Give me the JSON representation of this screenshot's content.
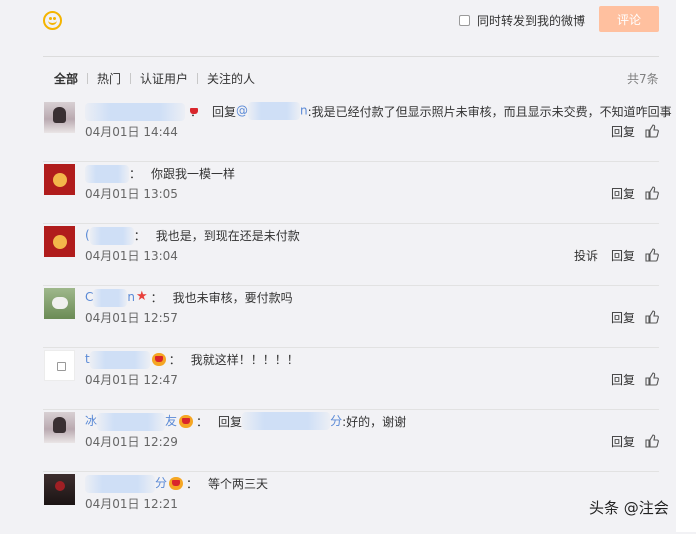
{
  "toolbar": {
    "repost_label": "同时转发到我的微博",
    "comment_button": "评论"
  },
  "filters": {
    "tabs": [
      "全部",
      "热门",
      "认证用户",
      "关注的人"
    ],
    "total": "共7条"
  },
  "comments": [
    {
      "user_visible_start": "",
      "user_visible_end": "",
      "badge": "crown",
      "reply_prefix": "回复",
      "mention_start": "@",
      "mention_end": "n",
      "text": ":我是已经付款了但显示照片未审核，而且显示未交费，不知道咋回事",
      "time": "04月01日 14:44",
      "actions": [
        "回复"
      ]
    },
    {
      "user_visible_start": "",
      "user_visible_end": "",
      "badge": "",
      "text": "你跟我一模一样",
      "time": "04月01日 13:05",
      "actions": [
        "回复"
      ]
    },
    {
      "user_visible_start": "(",
      "user_visible_end": "",
      "badge": "",
      "text": "我也是，到现在还是未付款",
      "time": "04月01日 13:04",
      "actions": [
        "投诉",
        "回复"
      ]
    },
    {
      "user_visible_start": "C",
      "user_visible_end": "n",
      "badge": "star",
      "text": "我也未审核，要付款吗",
      "time": "04月01日 12:57",
      "actions": [
        "回复"
      ]
    },
    {
      "user_visible_start": "t",
      "user_visible_end": "",
      "badge": "crown",
      "text": "我就这样！！！！！",
      "time": "04月01日 12:47",
      "actions": [
        "回复"
      ]
    },
    {
      "user_visible_start": "冰",
      "user_visible_end": "友",
      "badge": "crown",
      "reply_prefix": "回复",
      "mention_start": "",
      "mention_end": "分",
      "text": ":好的，谢谢",
      "time": "04月01日 12:29",
      "actions": [
        "回复"
      ]
    },
    {
      "user_visible_start": "",
      "user_visible_end": "分",
      "badge": "crown",
      "text": "等个两三天",
      "time": "04月01日 12:21",
      "actions": [
        "回复"
      ]
    }
  ],
  "watermark": "头条 @注会",
  "colors": {
    "link": "#5b8ad6",
    "comment_button_bg": "#ffc09f",
    "emoji": "#f4b400"
  }
}
